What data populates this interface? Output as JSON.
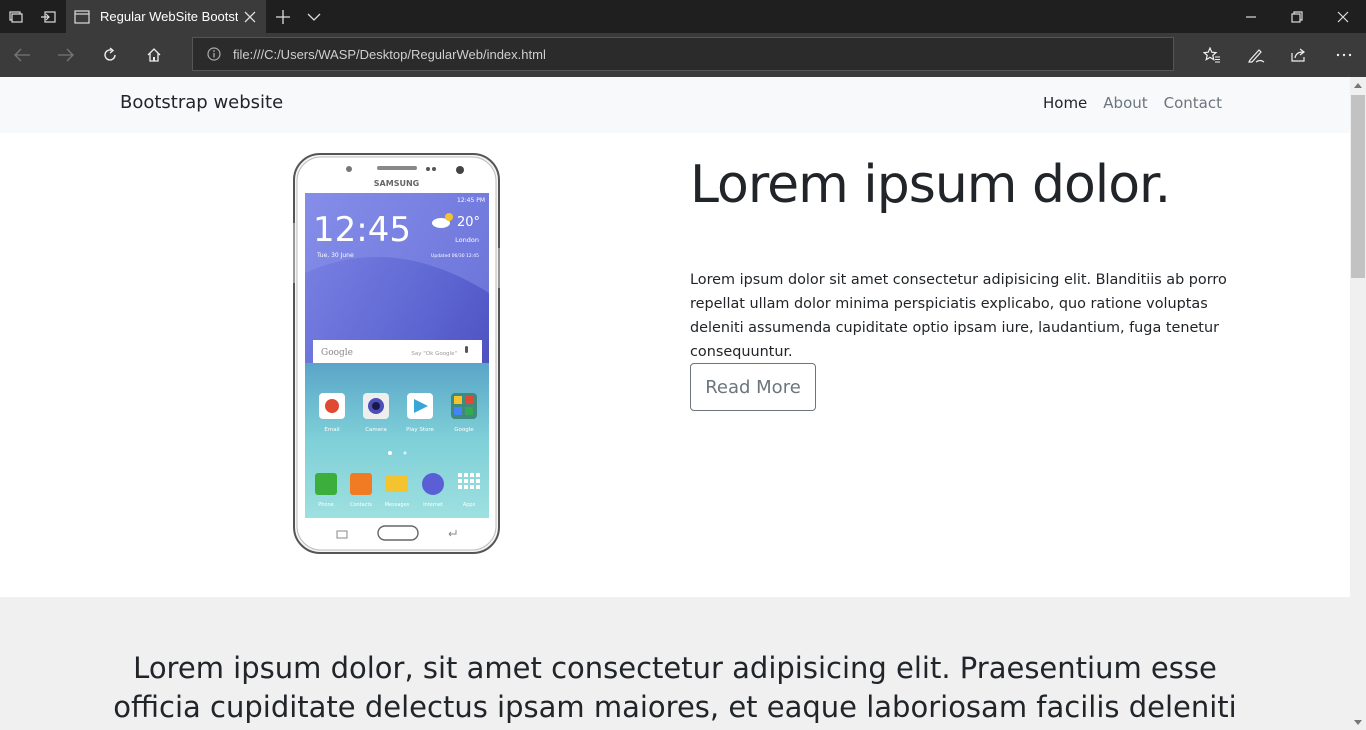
{
  "browser": {
    "tab_title": "Regular WebSite Bootst",
    "url": "file:///C:/Users/WASP/Desktop/RegularWeb/index.html"
  },
  "site": {
    "brand": "Bootstrap website",
    "nav": [
      "Home",
      "About",
      "Contact"
    ],
    "active_nav": "Home"
  },
  "hero": {
    "title": "Lorem ipsum dolor.",
    "text": "Lorem ipsum dolor sit amet consectetur adipisicing elit. Blanditiis ab porro repellat ullam dolor minima perspiciatis explicabo, quo ratione voluptas deleniti assumenda cupiditate optio ipsam iure, laudantium, fuga tenetur consequuntur.",
    "button": "Read More"
  },
  "phone_screen": {
    "brand": "SAMSUNG",
    "status_time": "12:45 PM",
    "clock": "12:45",
    "date": "Tue, 30 June",
    "temperature": "20°",
    "location": "London",
    "updated": "Updated 06/30 12:45",
    "search_placeholder": "Google",
    "voice_hint": "Say \"Ok Google\"",
    "apps_row1": [
      "Email",
      "Camera",
      "Play Store",
      "Google"
    ],
    "apps_row2": [
      "Phone",
      "Contacts",
      "Messages",
      "Internet",
      "Apps"
    ]
  },
  "lower": {
    "text": "Lorem ipsum dolor, sit amet consectetur adipisicing elit. Praesentium esse officia cupiditate delectus ipsam maiores, et eaque laboriosam facilis deleniti nulla vero"
  },
  "colors": {
    "chrome_dark": "#1f1f1f",
    "chrome_mid": "#3b3b3b",
    "site_nav_bg": "#f8f9fa",
    "lower_bg": "#f0f0f0",
    "text": "#212529",
    "muted": "#6c757d"
  }
}
